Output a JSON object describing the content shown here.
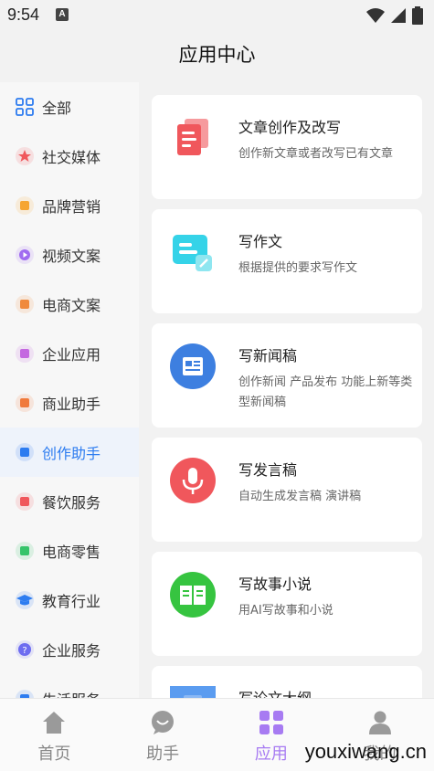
{
  "status": {
    "time": "9:54",
    "notif_letter": "A"
  },
  "header": {
    "title": "应用中心"
  },
  "sidebar": {
    "items": [
      {
        "label": "全部",
        "icon": "grid-icon",
        "color": "#2d7cf0",
        "active": false
      },
      {
        "label": "社交媒体",
        "icon": "star-icon",
        "color": "#f0575c",
        "active": false
      },
      {
        "label": "品牌营销",
        "icon": "megaphone-icon",
        "color": "#f6a531",
        "active": false
      },
      {
        "label": "视频文案",
        "icon": "play-icon",
        "color": "#a06cf0",
        "active": false
      },
      {
        "label": "电商文案",
        "icon": "cart-icon",
        "color": "#f08a3c",
        "active": false
      },
      {
        "label": "企业应用",
        "icon": "building-icon",
        "color": "#c468e0",
        "active": false
      },
      {
        "label": "商业助手",
        "icon": "chat-icon",
        "color": "#f07a3c",
        "active": false
      },
      {
        "label": "创作助手",
        "icon": "edit-icon",
        "color": "#2d7cf0",
        "active": true
      },
      {
        "label": "餐饮服务",
        "icon": "dish-icon",
        "color": "#f0575c",
        "active": false
      },
      {
        "label": "电商零售",
        "icon": "bag-icon",
        "color": "#36c46a",
        "active": false
      },
      {
        "label": "教育行业",
        "icon": "graduation-icon",
        "color": "#2d7cf0",
        "active": false
      },
      {
        "label": "企业服务",
        "icon": "help-icon",
        "color": "#6d6cf0",
        "active": false
      },
      {
        "label": "生活服务",
        "icon": "life-icon",
        "color": "#2d7cf0",
        "active": false
      }
    ]
  },
  "cards": [
    {
      "title": "文章创作及改写",
      "desc": "创作新文章或者改写已有文章",
      "icon": "document-icon",
      "color": "#f0575c"
    },
    {
      "title": "写作文",
      "desc": "根据提供的要求写作文",
      "icon": "essay-icon",
      "color": "#35d3e8"
    },
    {
      "title": "写新闻稿",
      "desc": "创作新闻 产品发布 功能上新等类型新闻稿",
      "icon": "news-icon",
      "color": "#3d7fe0"
    },
    {
      "title": "写发言稿",
      "desc": "自动生成发言稿 演讲稿",
      "icon": "microphone-icon",
      "color": "#f0575c"
    },
    {
      "title": "写故事小说",
      "desc": "用AI写故事和小说",
      "icon": "book-icon",
      "color": "#36c440"
    },
    {
      "title": "写论文大纲",
      "desc": "",
      "icon": "outline-icon",
      "color": "#5b9cf0"
    }
  ],
  "bottom_nav": {
    "items": [
      {
        "label": "首页",
        "icon": "home-icon",
        "active": false
      },
      {
        "label": "助手",
        "icon": "assistant-icon",
        "active": false
      },
      {
        "label": "应用",
        "icon": "apps-icon",
        "active": true
      },
      {
        "label": "我的",
        "icon": "profile-icon",
        "active": false
      }
    ]
  },
  "watermark": "youxiwang.cn"
}
